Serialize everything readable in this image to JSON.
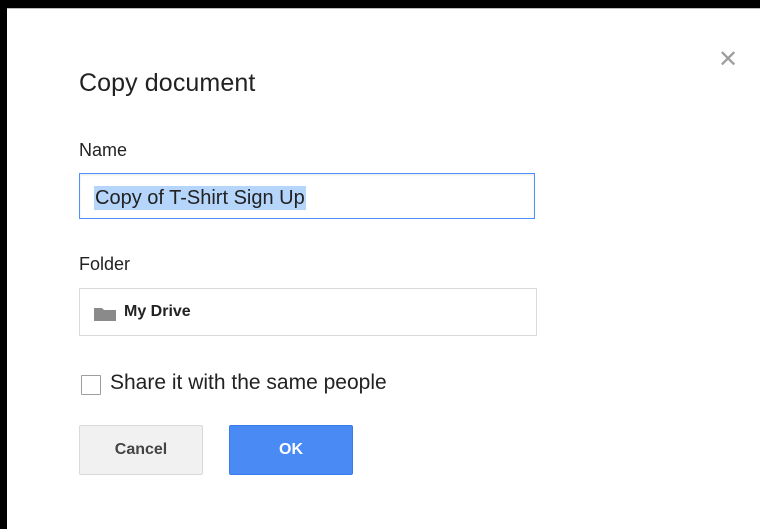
{
  "dialog": {
    "title": "Copy document",
    "close_icon": "close-icon",
    "name_label": "Name",
    "name_value": "Copy of T-Shirt Sign Up",
    "folder_label": "Folder",
    "folder_icon": "folder-icon",
    "folder_value": "My Drive",
    "share_checkbox_checked": false,
    "share_label": "Share it with the same people",
    "cancel_label": "Cancel",
    "ok_label": "OK"
  },
  "colors": {
    "primary_button": "#4a8af4",
    "input_focus_border": "#4d90fe",
    "selection_highlight": "#b5d5fb"
  }
}
